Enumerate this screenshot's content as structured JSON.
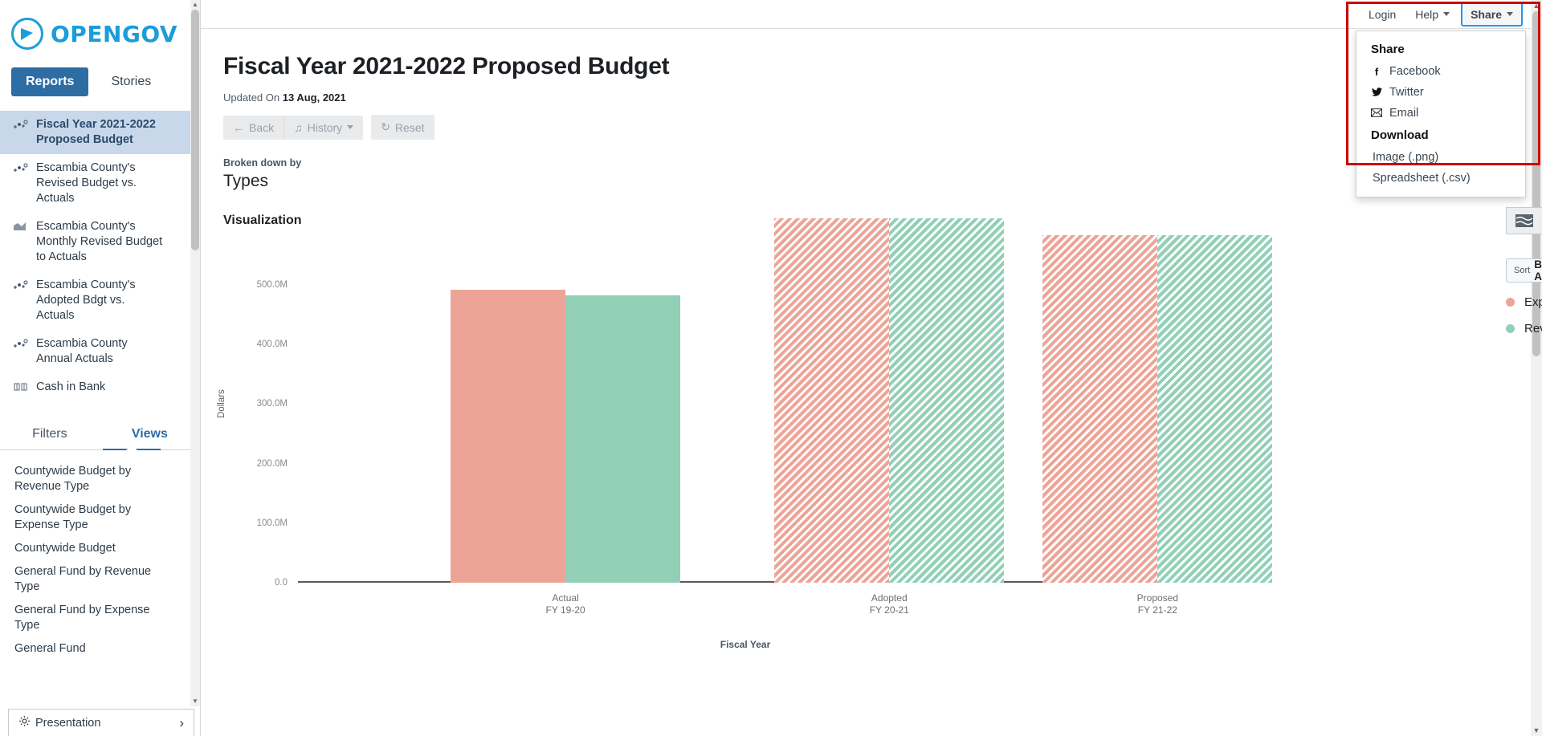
{
  "brand": {
    "name": "OPENGOV",
    "logo_icon": "opengov-logo-icon"
  },
  "sidebar": {
    "tabs": [
      {
        "label": "Reports",
        "active": true
      },
      {
        "label": "Stories",
        "active": false
      }
    ],
    "reports": [
      {
        "label": "Fiscal Year 2021-2022 Proposed Budget",
        "icon": "scatter-icon",
        "active": true
      },
      {
        "label": "Escambia County's Revised Budget vs. Actuals",
        "icon": "scatter-icon",
        "active": false
      },
      {
        "label": "Escambia County's Monthly Revised Budget to Actuals",
        "icon": "area-chart-icon",
        "active": false
      },
      {
        "label": "Escambia County's Adopted Bdgt vs. Actuals",
        "icon": "scatter-icon",
        "active": false
      },
      {
        "label": "Escambia County Annual Actuals",
        "icon": "scatter-icon",
        "active": false
      },
      {
        "label": "Cash in Bank",
        "icon": "balance-scale-icon",
        "active": false
      }
    ],
    "filter_view_tabs": [
      {
        "label": "Filters",
        "active": false
      },
      {
        "label": "Views",
        "active": true
      }
    ],
    "views": [
      "Countywide Budget by Revenue Type",
      "Countywide Budget by Expense Type",
      "Countywide Budget",
      "General Fund by Revenue Type",
      "General Fund by Expense Type",
      "General Fund"
    ],
    "presentation": {
      "label": "Presentation",
      "icon": "gear-icon",
      "chevron": "›"
    }
  },
  "topbar": {
    "login": "Login",
    "help": "Help",
    "share": "Share"
  },
  "share_menu": {
    "share_heading": "Share",
    "share_items": [
      {
        "label": "Facebook",
        "icon": "facebook-icon",
        "glyph": "f"
      },
      {
        "label": "Twitter",
        "icon": "twitter-icon",
        "glyph": "✉"
      },
      {
        "label": "Email",
        "icon": "email-icon",
        "glyph": "✉"
      }
    ],
    "download_heading": "Download",
    "download_items": [
      {
        "label": "Image (.png)"
      },
      {
        "label": "Spreadsheet (.csv)"
      }
    ]
  },
  "main": {
    "title": "Fiscal Year 2021-2022 Proposed Budget",
    "updated_prefix": "Updated On",
    "updated_date": "13 Aug, 2021",
    "buttons": {
      "back": "Back",
      "history": "History",
      "reset": "Reset"
    },
    "broken_down_by_label": "Broken down by",
    "broken_down_by_value": "Types",
    "visualization_label": "Visualization",
    "chart_toggle_icon": "area-chart-icon",
    "sort": {
      "prefix": "Sort",
      "value": "By Chart of Accounts"
    }
  },
  "colors": {
    "expenses": "#eda496",
    "revenues": "#92cfb7",
    "brand": "#1b9dd9",
    "accent": "#2e6da4",
    "highlight_box": "#cc0000",
    "focus_outline": "#2196f3"
  },
  "chart_data": {
    "type": "bar",
    "title": "",
    "xlabel": "Fiscal Year",
    "ylabel": "Dollars",
    "categories": [
      "Actual\nFY 19-20",
      "Adopted\nFY 20-21",
      "Proposed\nFY 21-22"
    ],
    "category_lines": [
      [
        "Actual",
        "FY 19-20"
      ],
      [
        "Adopted",
        "FY 20-21"
      ],
      [
        "Proposed",
        "FY 21-22"
      ]
    ],
    "ytick_labels": [
      "500.0M",
      "400.0M",
      "300.0M",
      "200.0M",
      "100.0M",
      "0.0"
    ],
    "ytick_values": [
      500000000,
      400000000,
      300000000,
      200000000,
      100000000,
      0
    ],
    "ylim": [
      0,
      550000000
    ],
    "grid": false,
    "legend_position": "right",
    "series": [
      {
        "name": "Expenses",
        "color": "#eda496",
        "values": [
          492000000,
          612000000,
          584000000
        ],
        "hatched": [
          false,
          true,
          true
        ]
      },
      {
        "name": "Revenues",
        "color": "#92cfb7",
        "values": [
          482000000,
          612000000,
          584000000
        ],
        "hatched": [
          false,
          true,
          true
        ]
      }
    ],
    "legend": [
      {
        "label": "Expenses",
        "color": "#eda496"
      },
      {
        "label": "Revenues",
        "color": "#92cfb7"
      }
    ]
  }
}
